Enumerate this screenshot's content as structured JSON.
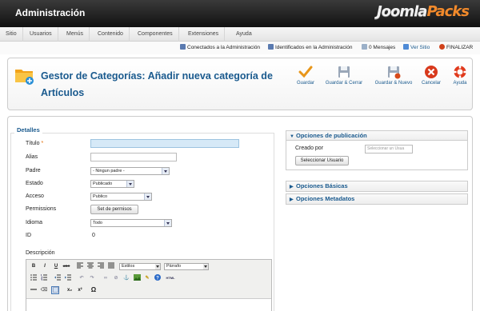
{
  "topbar": {
    "title": "Administración",
    "brand_a": "Joomla",
    "brand_b": "Packs"
  },
  "menu": [
    {
      "label": "Sitio"
    },
    {
      "label": "Usuarios"
    },
    {
      "label": "Menús"
    },
    {
      "label": "Contenido"
    },
    {
      "label": "Componentes"
    },
    {
      "label": "Extensiones"
    },
    {
      "label": "Ayuda"
    }
  ],
  "status": {
    "connected": "Conectados a la Administración",
    "identified": "Identificados en la Administración",
    "messages": "0 Mensajes",
    "view_site": "Ver Sitio",
    "logout": "FINALIZAR"
  },
  "page": {
    "title": "Gestor de Categorías: Añadir nueva categoría de Artículos"
  },
  "toolbar": {
    "save": "Guardar",
    "save_close": "Guardar & Cerrar",
    "save_new": "Guardar & Nuevo",
    "cancel": "Cancelar",
    "help": "Ayuda"
  },
  "details": {
    "legend": "Detalles",
    "title_label": "Título",
    "required_mark": "*",
    "title_value": "",
    "alias_label": "Alias",
    "alias_value": "",
    "parent_label": "Padre",
    "parent_value": "- Ningun padre -",
    "state_label": "Estado",
    "state_value": "Publicado",
    "access_label": "Acceso",
    "access_value": "Publico",
    "permissions_label": "Permissions",
    "permissions_button": "Set de permisos",
    "language_label": "Idioma",
    "language_value": "Todo",
    "id_label": "ID",
    "id_value": "0",
    "description_label": "Descripción"
  },
  "editor": {
    "bold": "B",
    "italic": "I",
    "underline": "U",
    "strike": "ABC",
    "styles": "Estilos",
    "format": "Párrafo",
    "subscript": "x₂",
    "superscript": "x²",
    "omega": "Ω",
    "html": "HTML"
  },
  "publishing": {
    "header": "Opciones de publicación",
    "created_by_label": "Creado por",
    "created_by_placeholder": "Seleccionar un Usua",
    "select_user_button": "Seleccionar Usuario"
  },
  "basic_options": {
    "header": "Opciones Básicas"
  },
  "metadata_options": {
    "header": "Opciones Metadatos"
  },
  "colors": {
    "accent": "#1a5a8e",
    "brand_orange": "#f28a2b",
    "title_highlight": "#d6e9f7"
  }
}
